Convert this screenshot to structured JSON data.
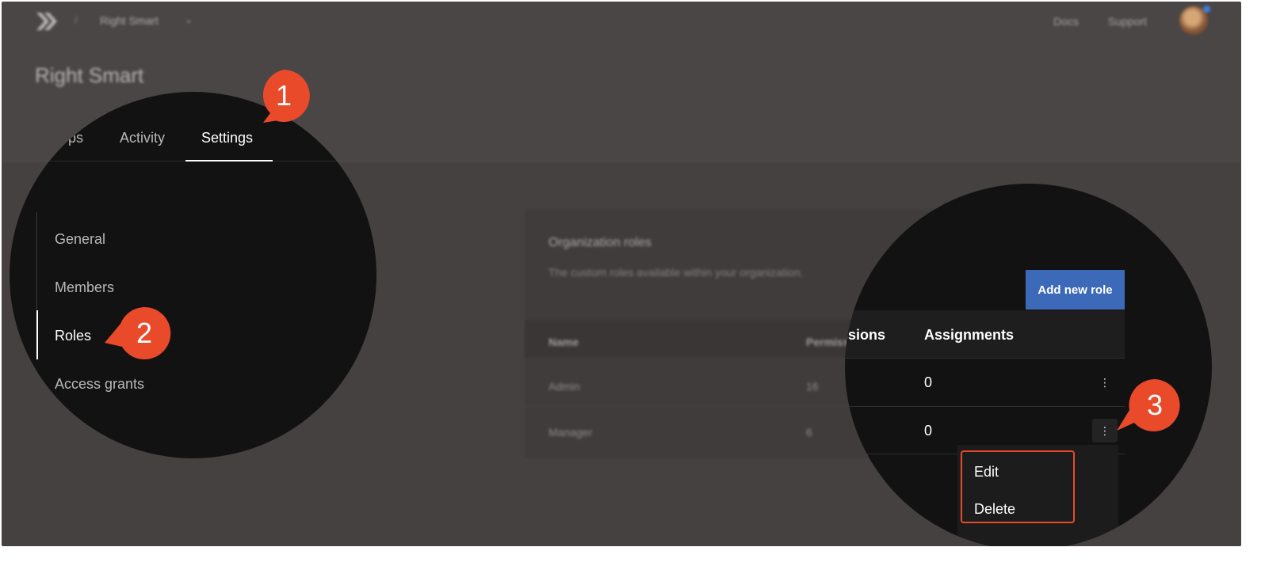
{
  "header": {
    "breadcrumb_org": "Right Smart",
    "docs_label": "Docs",
    "support_label": "Support"
  },
  "page": {
    "title": "Right Smart",
    "tabs": [
      {
        "label": "Apps"
      },
      {
        "label": "Activity"
      },
      {
        "label": "Settings",
        "active": true
      }
    ]
  },
  "sidebar": {
    "items": [
      {
        "label": "General"
      },
      {
        "label": "Members"
      },
      {
        "label": "Roles",
        "active": true
      },
      {
        "label": "Access grants"
      }
    ]
  },
  "roles_panel": {
    "title": "Organization roles",
    "subtitle": "The custom roles available within your organization.",
    "add_button": "Add new role",
    "columns": [
      "Name",
      "Permissions",
      "Assignments"
    ],
    "rows": [
      {
        "name": "Admin",
        "permissions": "16",
        "assignments": "0"
      },
      {
        "name": "Manager",
        "permissions": "6",
        "assignments": "0"
      }
    ],
    "row_menu": [
      "Edit",
      "Delete"
    ]
  },
  "callouts": [
    "1",
    "2",
    "3"
  ],
  "colors": {
    "callout": "#e84a2a",
    "primary_button": "#3d6ab8",
    "overlay": "#4a4645",
    "magnifier": "#131213"
  }
}
